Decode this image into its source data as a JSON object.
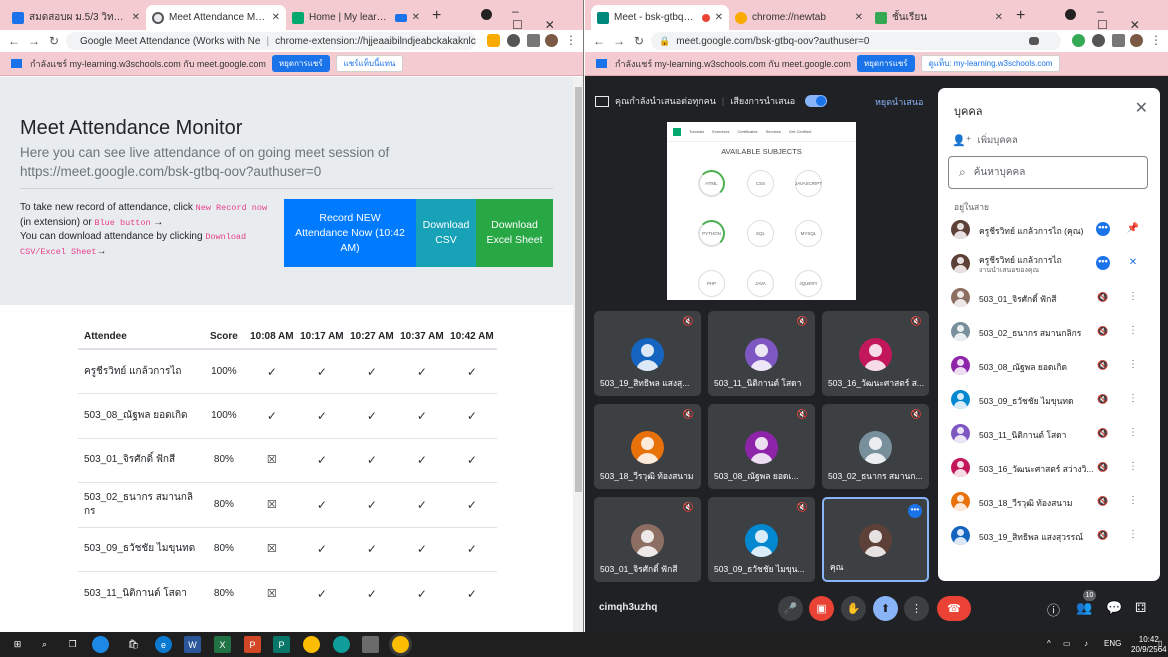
{
  "left_window": {
    "tabs": [
      {
        "title": "สมดสอบผ ม.5/3 วิทยอนเมื่อเช้น"
      },
      {
        "title": "Meet Attendance Monitor"
      },
      {
        "title": "Home | My learning | W3S"
      }
    ],
    "url": "chrome-extension://hjjeaaibilndjeabckakaknlcb...",
    "url_title": "Google Meet Attendance (Works with Ne",
    "info": {
      "text": "กำลังแชร์ my-learning.w3schools.com กับ meet.google.com",
      "stop": "หยุดการแชร์",
      "switch": "แชร์แท็บนี้แทน"
    },
    "page": {
      "title": "Meet Attendance Monitor",
      "lead": "Here you can see live attendance of on going meet session of https://meet.google.com/bsk-gtbq-oov?authuser=0",
      "instr1a": "To take new record of attendance, click ",
      "instr1code": "New Record now",
      "instr1b": " (in extension) or ",
      "instr1code2": "Blue button",
      "instr1arrow": " →",
      "instr2a": "You can download attendance by clicking ",
      "instr2code": "Download CSV/Excel Sheet",
      "instr2arrow": "→",
      "btn_record": "Record NEW Attendance Now (10:42 AM)",
      "btn_csv": "Download CSV",
      "btn_excel": "Download Excel Sheet"
    },
    "table": {
      "headers": {
        "attendee": "Attendee",
        "score": "Score",
        "t1": "10:08 AM",
        "t2": "10:17 AM",
        "t3": "10:27 AM",
        "t4": "10:37 AM",
        "t5": "10:42 AM"
      },
      "rows": [
        {
          "name": "ครูชีรวิทย์ แกล้วการไถ",
          "score": "100%",
          "marks": [
            "✓",
            "✓",
            "✓",
            "✓",
            "✓"
          ]
        },
        {
          "name": "503_08_ณัฐพล ยอดเกิด",
          "score": "100%",
          "marks": [
            "✓",
            "✓",
            "✓",
            "✓",
            "✓"
          ]
        },
        {
          "name": "503_01_จิรศักดิ์ ฟักสี",
          "score": "80%",
          "marks": [
            "☒",
            "✓",
            "✓",
            "✓",
            "✓"
          ]
        },
        {
          "name": "503_02_ธนากร สมานกลิกร",
          "score": "80%",
          "marks": [
            "☒",
            "✓",
            "✓",
            "✓",
            "✓"
          ]
        },
        {
          "name": "503_09_ธวัชชัย ไมขุนทด",
          "score": "80%",
          "marks": [
            "☒",
            "✓",
            "✓",
            "✓",
            "✓"
          ]
        },
        {
          "name": "503_11_นิติกานต์ โสดา",
          "score": "80%",
          "marks": [
            "☒",
            "✓",
            "✓",
            "✓",
            "✓"
          ]
        }
      ]
    }
  },
  "right_window": {
    "tabs": [
      {
        "title": "Meet - bsk-gtbq-oov"
      },
      {
        "title": "chrome://newtab"
      },
      {
        "title": "ชั้นเรียน"
      }
    ],
    "url": "meet.google.com/bsk-gtbq-oov?authuser=0",
    "info": {
      "text": "กำลังแชร์ my-learning.w3schools.com กับ meet.google.com",
      "stop": "หยุดการแชร์",
      "switch": "ดูแท็บ: my-learning.w3schools.com"
    },
    "presenting": "คุณกำลังนำเสนอต่อทุกคน",
    "audio": "เสียงการนำเสนอ",
    "stop_presenting": "หยุดนำเสนอ",
    "slide": {
      "title": "AVAILABLE SUBJECTS",
      "nav": [
        "w3schools",
        "Tutorials",
        "Exercises",
        "Certificates",
        "Services",
        "Get Certified"
      ],
      "subjects": [
        "HTML",
        "CSS",
        "JAVASCRIPT",
        "PYTHON",
        "SQL",
        "MYSQL",
        "PHP",
        "JAVA",
        "JQUERY"
      ]
    },
    "tiles": [
      {
        "name": "503_19_สิทธิพล แสงสุ..."
      },
      {
        "name": "503_11_นิติกานต์ โสดา"
      },
      {
        "name": "503_16_วัฒนะศาสตร์ ส..."
      },
      {
        "name": "503_18_วีรวุฒิ ท้องสนาม"
      },
      {
        "name": "503_08_ณัฐพล ยอดเ..."
      },
      {
        "name": "503_02_ธนากร สมานก..."
      },
      {
        "name": "503_01_จิรศักดิ์ ฟักสี"
      },
      {
        "name": "503_09_ธวัชชัย ไมขุน..."
      },
      {
        "name": "คุณ"
      }
    ],
    "people": {
      "title": "บุคคล",
      "add": "เพิ่มบุคคล",
      "search_placeholder": "ค้นหาบุคคล",
      "section": "อยู่ในสาย",
      "list": [
        {
          "name": "ครูชีรวิทย์ แกล้วการไถ (คุณ)",
          "sub": ""
        },
        {
          "name": "ครูชีรวิทย์ แกล้วการไถ",
          "sub": "งานนำเสนอของคุณ"
        },
        {
          "name": "503_01_จิรศักดิ์ ฟักสี",
          "sub": ""
        },
        {
          "name": "503_02_ธนากร สมานกลิกร",
          "sub": ""
        },
        {
          "name": "503_08_ณัฐพล ยอดเกิด",
          "sub": ""
        },
        {
          "name": "503_09_ธวัชชัย ไมขุนทด",
          "sub": ""
        },
        {
          "name": "503_11_นิติกานต์ โสดา",
          "sub": ""
        },
        {
          "name": "503_16_วัฒนะศาสตร์ สว่างวิ...",
          "sub": ""
        },
        {
          "name": "503_18_วีรวุฒิ ท้องสนาม",
          "sub": ""
        },
        {
          "name": "503_19_สิทธิพล แสงสุวรรณ์",
          "sub": ""
        }
      ]
    },
    "meeting_code": "cimqh3uzhq",
    "people_count": "10"
  },
  "taskbar": {
    "lang": "ENG",
    "time": "10:42",
    "date": "20/9/2564"
  }
}
